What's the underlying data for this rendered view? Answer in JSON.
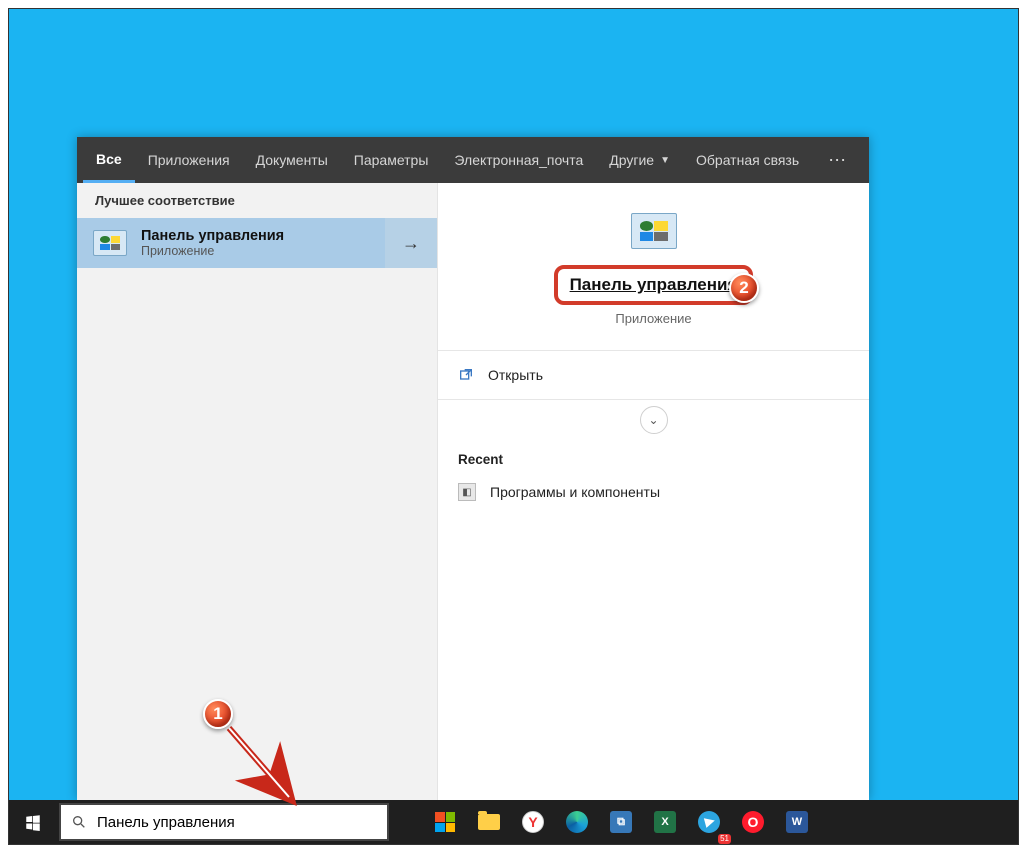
{
  "tabs": {
    "all": "Все",
    "apps": "Приложения",
    "docs": "Документы",
    "settings": "Параметры",
    "email": "Электронная_почта",
    "more": "Другие",
    "feedback": "Обратная связь"
  },
  "left": {
    "best_match_header": "Лучшее соответствие",
    "result_title": "Панель управления",
    "result_sub": "Приложение"
  },
  "right": {
    "title": "Панель управления",
    "sub": "Приложение",
    "open": "Открыть",
    "recent_header": "Recent",
    "recent_item": "Программы и компоненты"
  },
  "search": {
    "value": "Панель управления"
  },
  "callouts": {
    "c1": "1",
    "c2": "2"
  },
  "task_labels": {
    "excel": "X",
    "word": "W",
    "yandex": "Y",
    "opera": "O",
    "tg_badge": "51",
    "generic": "⧉"
  }
}
